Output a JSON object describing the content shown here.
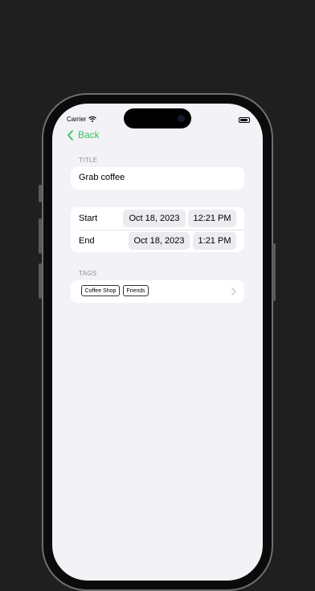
{
  "status_bar": {
    "carrier": "Carrier"
  },
  "nav": {
    "back_label": "Back"
  },
  "title_section": {
    "label": "TITLE",
    "value": "Grab coffee"
  },
  "dates": {
    "start": {
      "label": "Start",
      "date": "Oct 18, 2023",
      "time": "12:21 PM"
    },
    "end": {
      "label": "End",
      "date": "Oct 18, 2023",
      "time": "1:21 PM"
    }
  },
  "tags_section": {
    "label": "TAGS",
    "tags": [
      "Coffee Shop",
      "Friends"
    ]
  },
  "colors": {
    "accent": "#34c759",
    "background": "#f2f2f7",
    "card": "#ffffff",
    "secondary_label": "#8e8e93"
  },
  "icons": [
    "wifi-icon",
    "battery-icon",
    "chevron-left-icon",
    "chevron-right-icon"
  ]
}
